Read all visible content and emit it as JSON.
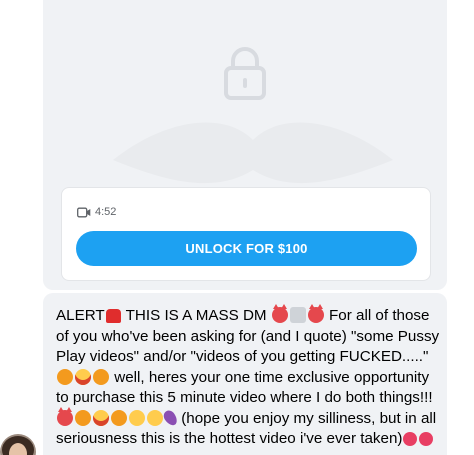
{
  "locked_post": {
    "lock_icon": "padlock-icon",
    "media_icon": "video-camera-icon",
    "duration": "4:52",
    "unlock_label": "UNLOCK FOR $100",
    "accent_color": "#1da1f2"
  },
  "message": {
    "segments": [
      {
        "t": "ALERT"
      },
      {
        "e": "siren"
      },
      {
        "t": " THIS IS A MASS DM "
      },
      {
        "e": "devil"
      },
      {
        "e": "bunny"
      },
      {
        "e": "devil"
      },
      {
        "t": " For all of those of you who've been asking for (and I quote) \"some Pussy Play videos\" and/or \"videos of you getting FUCKED.....\" "
      },
      {
        "e": "orange"
      },
      {
        "e": "grin"
      },
      {
        "e": "orange"
      },
      {
        "t": " well, heres your one time exclusive opportunity to purchase this 5 minute video where I do both things!!! "
      },
      {
        "e": "devil"
      },
      {
        "e": "orange"
      },
      {
        "e": "grin"
      },
      {
        "e": "orange"
      },
      {
        "e": "yellow"
      },
      {
        "e": "yellow"
      },
      {
        "e": "eggplant"
      },
      {
        "t": " (hope you enjoy my silliness, but in all seriousness this is the hottest video i've ever taken)"
      },
      {
        "e": "hearts"
      },
      {
        "e": "hearts"
      }
    ]
  },
  "sender": {
    "avatar": "sender-avatar"
  }
}
